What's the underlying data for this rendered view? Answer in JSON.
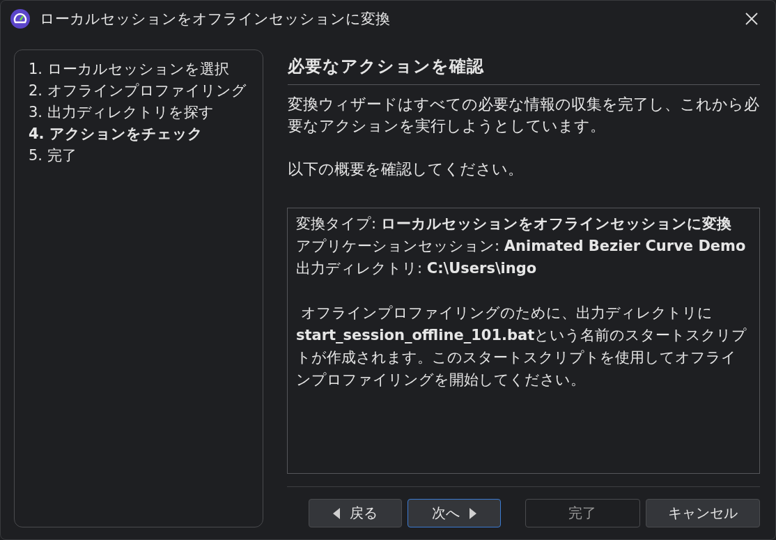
{
  "window": {
    "title": "ローカルセッションをオフラインセッションに変換"
  },
  "steps": [
    {
      "label": "1. ローカルセッションを選択",
      "selected": false
    },
    {
      "label": "2. オフラインプロファイリング",
      "selected": false
    },
    {
      "label": "3. 出力ディレクトリを探す",
      "selected": false
    },
    {
      "label": "4. アクションをチェック",
      "selected": true
    },
    {
      "label": "5. 完了",
      "selected": false
    }
  ],
  "page": {
    "heading": "必要なアクションを確認",
    "intro": [
      "変換ウィザードはすべての必要な情報の収集を完了し、これから必要なアクションを実行しようとしています。",
      "以下の概要を確認してください。"
    ],
    "summary": [
      "変換タイプ: **ローカルセッションをオフラインセッションに変換**",
      "アプリケーションセッション: **Animated Bezier Curve Demo**",
      "出力ディレクトリ: **C:\\Users\\ingo**"
    ],
    "note": " オフラインプロファイリングのために、出力ディレクトリに**start_session_offline_101.bat**という名前のスタートスクリプトが作成されます。このスタートスクリプトを使用してオフラインプロファイリングを開始してください。"
  },
  "buttons": [
    {
      "label": "戻る",
      "kind": "back",
      "focused": false,
      "disabled": false
    },
    {
      "label": "次へ",
      "kind": "next",
      "focused": true,
      "disabled": false
    },
    {
      "label": "完了",
      "kind": "plain",
      "focused": false,
      "disabled": true
    },
    {
      "label": "キャンセル",
      "kind": "plain",
      "focused": false,
      "disabled": false
    }
  ]
}
